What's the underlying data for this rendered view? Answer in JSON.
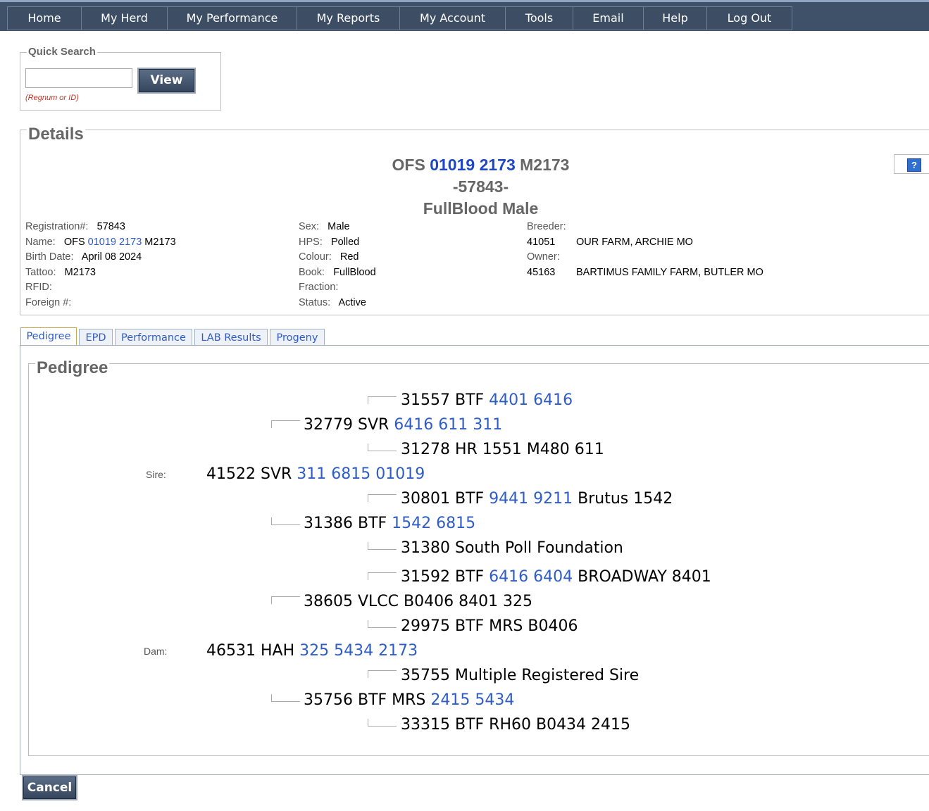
{
  "nav": [
    "Home",
    "My Herd",
    "My Performance",
    "My Reports",
    "My Account",
    "Tools",
    "Email",
    "Help",
    "Log Out"
  ],
  "quick_search": {
    "legend": "Quick Search",
    "button": "View",
    "hint": "(Regnum or ID)",
    "value": ""
  },
  "details": {
    "legend": "Details",
    "title_prefix": "OFS",
    "title_link": "01019 2173",
    "title_suffix": "M2173",
    "regline": "-57843-",
    "subtitle": "FullBlood Male",
    "help": "?",
    "left": {
      "registration_label": "Registration#:",
      "registration": "57843",
      "name_label": "Name:",
      "name_prefix": "OFS",
      "name_link": "01019 2173",
      "name_suffix": "M2173",
      "birth_label": "Birth Date:",
      "birth": "April 08 2024",
      "tattoo_label": "Tattoo:",
      "tattoo": "M2173",
      "rfid_label": "RFID:",
      "foreign_label": "Foreign #:"
    },
    "mid": {
      "sex_label": "Sex:",
      "sex": "Male",
      "hps_label": "HPS:",
      "hps": "Polled",
      "colour_label": "Colour:",
      "colour": "Red",
      "book_label": "Book:",
      "book": "FullBlood",
      "fraction_label": "Fraction:",
      "status_label": "Status:",
      "status": "Active"
    },
    "right": {
      "breeder_label": "Breeder:",
      "breeder_id": "41051",
      "breeder_name": "OUR FARM, ARCHIE MO",
      "owner_label": "Owner:",
      "owner_id": "45163",
      "owner_name": "BARTIMUS FAMILY FARM, BUTLER MO"
    }
  },
  "tabs": [
    "Pedigree",
    "EPD",
    "Performance",
    "LAB Results",
    "Progeny"
  ],
  "pedigree": {
    "legend": "Pedigree",
    "sire_label": "Sire:",
    "dam_label": "Dam:",
    "sire": {
      "pre": "41522 SVR",
      "link": "311 6815 01019",
      "post": ""
    },
    "dam": {
      "pre": "46531 HAH",
      "link": "325 5434 2173",
      "post": ""
    },
    "ss": {
      "pre": "32779 SVR",
      "link": "6416 611 311",
      "post": ""
    },
    "sss": {
      "pre": "31557 BTF",
      "link": "4401 6416",
      "post": ""
    },
    "ssd": {
      "pre": "31278 HR 1551 M480 611",
      "link": "",
      "post": ""
    },
    "sd": {
      "pre": "31386 BTF",
      "link": "1542 6815",
      "post": ""
    },
    "sds": {
      "pre": "30801 BTF",
      "link": "9441 9211",
      "post": "Brutus 1542"
    },
    "sdd": {
      "pre": "31380 South Poll Foundation",
      "link": "",
      "post": ""
    },
    "ds": {
      "pre": "38605 VLCC B0406 8401 325",
      "link": "",
      "post": ""
    },
    "dss": {
      "pre": "31592 BTF",
      "link": "6416 6404",
      "post": "BROADWAY 8401"
    },
    "dsd": {
      "pre": "29975 BTF MRS B0406",
      "link": "",
      "post": ""
    },
    "dd": {
      "pre": "35756 BTF MRS",
      "link": "2415 5434",
      "post": ""
    },
    "dds": {
      "pre": "35755 Multiple Registered Sire",
      "link": "",
      "post": ""
    },
    "ddd": {
      "pre": "33315 BTF RH60 B0434 2415",
      "link": "",
      "post": ""
    }
  },
  "cancel": "Cancel"
}
